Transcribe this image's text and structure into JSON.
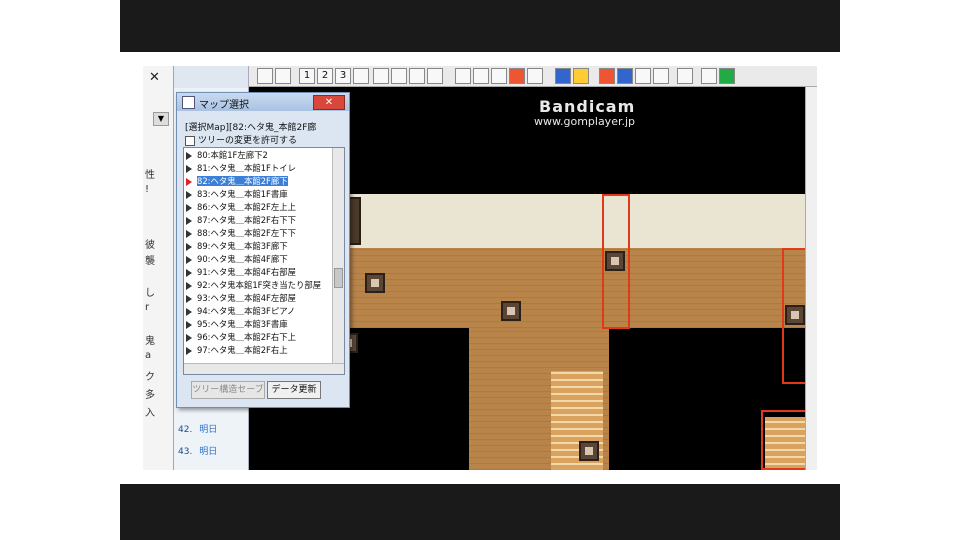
{
  "watermark": {
    "brand": "Bandicam",
    "url": "www.gomplayer.jp"
  },
  "left_panel": {
    "close": "✕",
    "scroll": "▼",
    "chars": [
      "性",
      "!",
      "彼",
      "襲",
      "し",
      "r",
      "鬼",
      "a",
      "ク",
      "多",
      "入"
    ]
  },
  "event_list": {
    "rows": [
      {
        "num": "42.",
        "text": "明日"
      },
      {
        "num": "43.",
        "text": "明日"
      }
    ]
  },
  "toolbar": {
    "layer1": "1",
    "layer2": "2",
    "layer3": "3"
  },
  "dialog": {
    "title": "マップ選択",
    "close": "✕",
    "selected_label": "[選択Map][82:ヘタ鬼_本館2F廊",
    "allow_tree_change": "ツリーの変更を許可する",
    "items": [
      {
        "label": "80:本館1F左廊下2",
        "selected": false
      },
      {
        "label": "81:ヘタ鬼＿本館1Fトイレ",
        "selected": false
      },
      {
        "label": "82:ヘタ鬼＿本館2F廊下",
        "selected": true
      },
      {
        "label": "83:ヘタ鬼＿本館1F書庫",
        "selected": false
      },
      {
        "label": "86:ヘタ鬼＿本館2F左上上",
        "selected": false
      },
      {
        "label": "87:ヘタ鬼＿本館2F右下下",
        "selected": false
      },
      {
        "label": "88:ヘタ鬼＿本館2F左下下",
        "selected": false
      },
      {
        "label": "89:ヘタ鬼＿本館3F廊下",
        "selected": false
      },
      {
        "label": "90:ヘタ鬼＿本館4F廊下",
        "selected": false
      },
      {
        "label": "91:ヘタ鬼＿本館4F右部屋",
        "selected": false
      },
      {
        "label": "92:ヘタ鬼本館1F突き当たり部屋",
        "selected": false
      },
      {
        "label": "93:ヘタ鬼＿本館4F左部屋",
        "selected": false
      },
      {
        "label": "94:ヘタ鬼＿本館3Fピアノ",
        "selected": false
      },
      {
        "label": "95:ヘタ鬼＿本館3F書庫",
        "selected": false
      },
      {
        "label": "96:ヘタ鬼＿本館2F右下上",
        "selected": false
      },
      {
        "label": "97:ヘタ鬼＿本館2F右上",
        "selected": false
      }
    ],
    "button_tree_edit": "ツリー構造セーブ",
    "button_refresh": "データ更新"
  }
}
